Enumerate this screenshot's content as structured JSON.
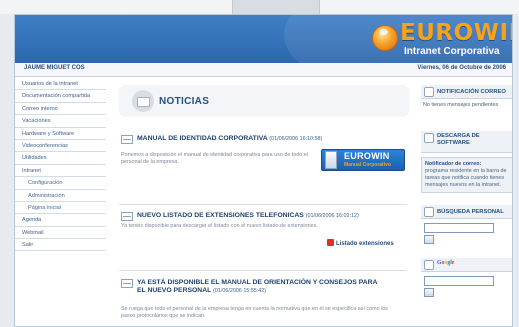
{
  "brand": {
    "name": "EUROWIN",
    "subtitle": "Intranet Corporativa"
  },
  "userbar": {
    "user": "JAUME MIGUET COS",
    "date": "Viernes, 06 de Octubre de 2006"
  },
  "sidebar": {
    "items": [
      {
        "label": "Usuarios de la intranet"
      },
      {
        "label": "Documentación compartida"
      },
      {
        "label": "Correo interno"
      },
      {
        "label": "Vacaciones"
      },
      {
        "label": "Hardware y Software"
      },
      {
        "label": "Videoconferencias"
      },
      {
        "label": "Utilidades"
      },
      {
        "label": "Intranet"
      },
      {
        "label": "Configuración"
      },
      {
        "label": "Administración"
      },
      {
        "label": "Página inicial"
      },
      {
        "label": "Agenda"
      },
      {
        "label": "Webmail"
      },
      {
        "label": "Salir"
      }
    ]
  },
  "content": {
    "title": "NOTICIAS",
    "news": [
      {
        "title": "MANUAL DE IDENTIDAD CORPORATIVA",
        "date": "(01/06/2006 16:10:58)",
        "body": "Ponemos a disposición el manual de identidad corporativa para uso de todo el personal de la empresa.",
        "badge_title": "EUROWIN",
        "badge_sub": "Manual Corporativo"
      },
      {
        "title": "NUEVO LISTADO DE EXTENSIONES TELEFONICAS",
        "date": "(01/06/2006 16:02:12)",
        "body": "Ya tenéis disponible para descargar el listado con el nuevo listado de extensiones.",
        "link": "Listado extensiones"
      },
      {
        "title": "YA ESTÁ DISPONIBLE EL MANUAL DE ORIENTACIÓN Y CONSEJOS PARA EL NUEVO PERSONAL",
        "date": "(01/06/2006 15:55:42)",
        "body": "Se ruega que todo el personal de la empresa tenga en cuenta la normativa que en él se especifica así como los pasos protocolarios que se indican."
      }
    ]
  },
  "right": {
    "mail": {
      "title": "NOTIFICACIÓN CORREO",
      "text": "No tienes mensajes pendientes"
    },
    "download": {
      "title": "DESCARGA DE SOFTWARE",
      "notifier_title": "Notificador de correo:",
      "notifier_text": "programa residente en la barra de tareas que notifica cuando tienes mensajes nuevos en la intranet."
    },
    "search": {
      "title": "BÚSQUEDA PERSONAL"
    },
    "google": {
      "title": "Google"
    }
  }
}
